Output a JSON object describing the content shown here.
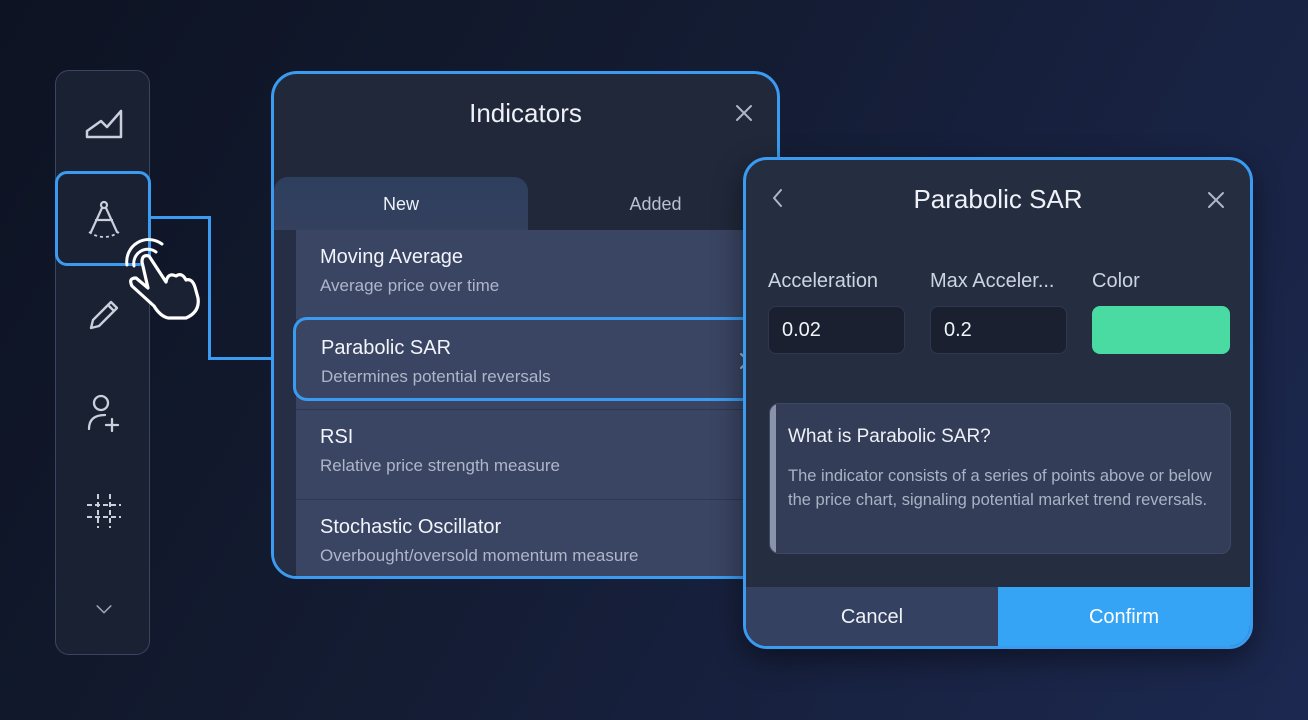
{
  "sidebar": {
    "items": [
      {
        "icon": "area-chart-icon"
      },
      {
        "icon": "drawing-compass-icon"
      },
      {
        "icon": "pencil-icon"
      },
      {
        "icon": "add-user-icon"
      },
      {
        "icon": "crosshair-icon"
      },
      {
        "icon": "chevron-down-icon"
      }
    ],
    "active_index": 1
  },
  "indicators": {
    "title": "Indicators",
    "tabs": [
      {
        "label": "New",
        "active": true
      },
      {
        "label": "Added",
        "active": false
      }
    ],
    "items": [
      {
        "title": "Moving Average",
        "subtitle": "Average price over time"
      },
      {
        "title": "Parabolic SAR",
        "subtitle": "Determines potential reversals",
        "selected": true
      },
      {
        "title": "RSI",
        "subtitle": "Relative price strength measure"
      },
      {
        "title": "Stochastic Oscillator",
        "subtitle": "Overbought/oversold momentum measure"
      }
    ]
  },
  "sar": {
    "title": "Parabolic SAR",
    "fields": {
      "acceleration": {
        "label": "Acceleration",
        "value": "0.02"
      },
      "max_acceleration": {
        "label": "Max Acceler...",
        "value": "0.2"
      },
      "color": {
        "label": "Color",
        "value": "#49dba1"
      }
    },
    "info": {
      "title": "What is Parabolic SAR?",
      "text": "The indicator consists of a series of points above or below the price chart, signaling potential market trend reversals."
    },
    "cancel_label": "Cancel",
    "confirm_label": "Confirm"
  },
  "colors": {
    "accent": "#3b9bf0",
    "confirm": "#35a4f5",
    "swatch": "#49dba1"
  }
}
